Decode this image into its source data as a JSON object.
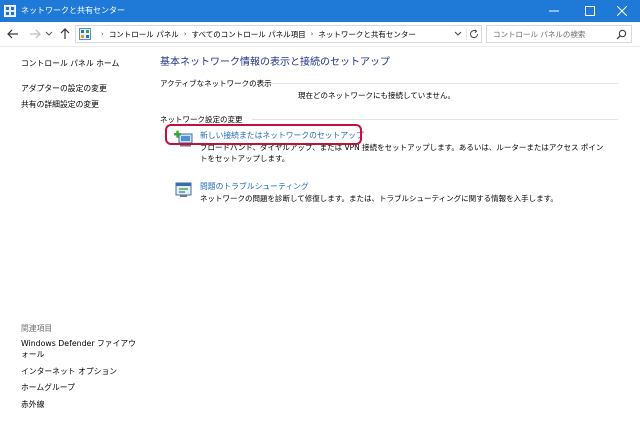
{
  "window": {
    "title": "ネットワークと共有センター"
  },
  "address": {
    "crumbs": [
      "コントロール パネル",
      "すべてのコントロール パネル項目",
      "ネットワークと共有センター"
    ],
    "search_placeholder": "コントロール パネルの検索"
  },
  "sidebar": {
    "home": "コントロール パネル ホーム",
    "links": [
      "アダプターの設定の変更",
      "共有の詳細設定の変更"
    ],
    "related_heading": "関連項目",
    "related": [
      "Windows Defender ファイアウォール",
      "インターネット オプション",
      "ホームグループ",
      "赤外線"
    ]
  },
  "main": {
    "title": "基本ネットワーク情報の表示と接続のセットアップ",
    "active_heading": "アクティブなネットワークの表示",
    "no_network": "現在どのネットワークにも接続していません。",
    "change_heading": "ネットワーク設定の変更",
    "tasks": [
      {
        "label": "新しい接続またはネットワークのセットアップ",
        "desc": "ブロードバンド、ダイヤルアップ、または VPN 接続をセットアップします。あるいは、ルーターまたはアクセス ポイントをセットアップします。",
        "icon": "network-setup-icon"
      },
      {
        "label": "問題のトラブルシューティング",
        "desc": "ネットワークの問題を診断して修復します。または、トラブルシューティングに関する情報を入手します。",
        "icon": "troubleshoot-icon"
      }
    ]
  },
  "colors": {
    "titlebar": "#1e7ad6",
    "link": "#1d67b3",
    "page_title": "#1e3287",
    "highlight": "#c1123b"
  }
}
